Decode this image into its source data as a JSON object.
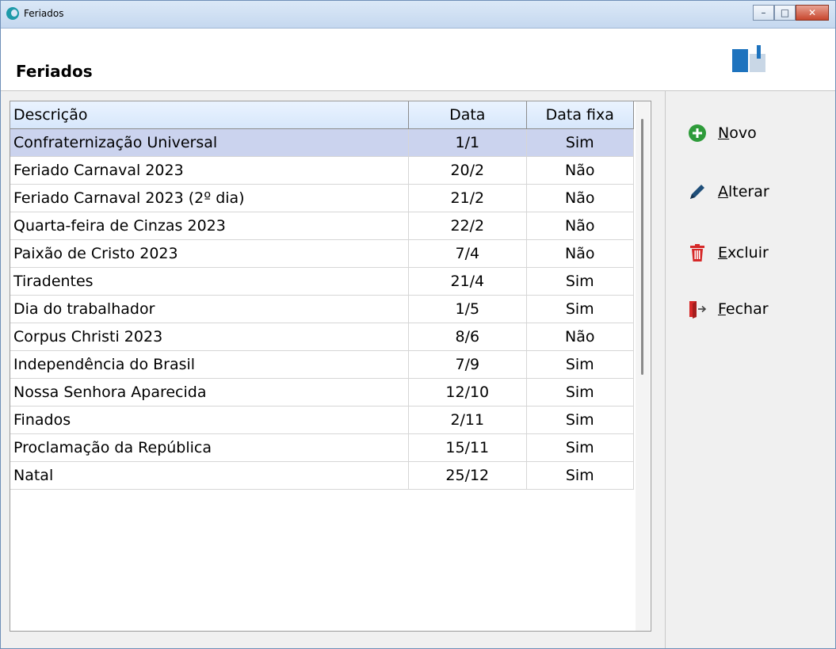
{
  "window": {
    "title": "Feriados"
  },
  "header": {
    "title": "Feriados"
  },
  "table": {
    "columns": [
      "Descrição",
      "Data",
      "Data fixa"
    ],
    "rows": [
      [
        "Confraternização Universal",
        "1/1",
        "Sim"
      ],
      [
        "Feriado Carnaval 2023",
        "20/2",
        "Não"
      ],
      [
        "Feriado Carnaval 2023 (2º dia)",
        "21/2",
        "Não"
      ],
      [
        "Quarta-feira de Cinzas 2023",
        "22/2",
        "Não"
      ],
      [
        "Paixão de Cristo 2023",
        "7/4",
        "Não"
      ],
      [
        "Tiradentes",
        "21/4",
        "Sim"
      ],
      [
        "Dia do trabalhador",
        "1/5",
        "Sim"
      ],
      [
        "Corpus Christi 2023",
        "8/6",
        "Não"
      ],
      [
        "Independência do Brasil",
        "7/9",
        "Sim"
      ],
      [
        "Nossa Senhora Aparecida",
        "12/10",
        "Sim"
      ],
      [
        "Finados",
        "2/11",
        "Sim"
      ],
      [
        "Proclamação da República",
        "15/11",
        "Sim"
      ],
      [
        "Natal",
        "25/12",
        "Sim"
      ]
    ],
    "selected_row": 0
  },
  "actions": [
    {
      "key": "N",
      "rest": "ovo",
      "icon": "add-circle-icon",
      "color": "#2e9b3a"
    },
    {
      "key": "A",
      "rest": "lterar",
      "icon": "pencil-icon",
      "color": "#1f4e79"
    },
    {
      "key": "E",
      "rest": "xcluir",
      "icon": "trash-icon",
      "color": "#d62828"
    },
    {
      "key": "F",
      "rest": "echar",
      "icon": "exit-door-icon",
      "color": "#d62828"
    }
  ]
}
